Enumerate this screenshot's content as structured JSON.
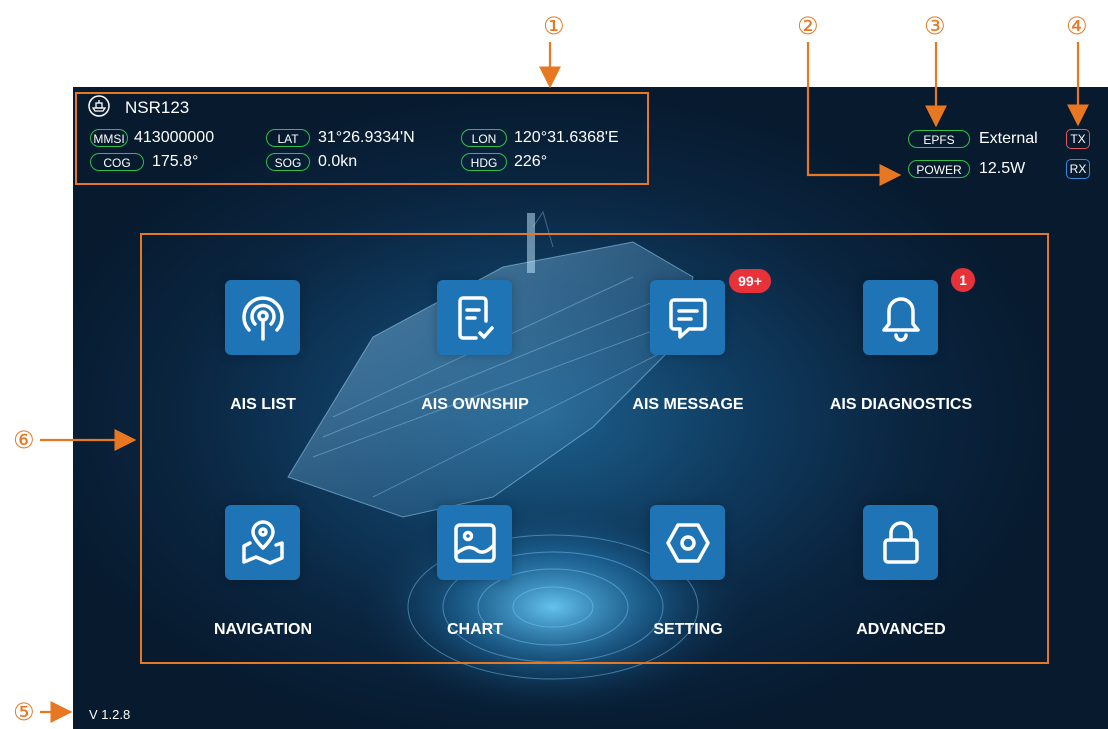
{
  "markers": {
    "m1": "①",
    "m2": "②",
    "m3": "③",
    "m4": "④",
    "m5": "⑤",
    "m6": "⑥"
  },
  "status_bar": {
    "ship_name": "NSR123",
    "mmsi_tag": "MMSI",
    "mmsi_value": "413000000",
    "lat_tag": "LAT",
    "lat_value": "31°26.9334'N",
    "lon_tag": "LON",
    "lon_value": "120°31.6368'E",
    "cog_tag": "COG",
    "cog_value": "175.8°",
    "sog_tag": "SOG",
    "sog_value": "0.0kn",
    "hdg_tag": "HDG",
    "hdg_value": "226°",
    "epfs_tag": "EPFS",
    "epfs_value": "External",
    "power_tag": "POWER",
    "power_value": "12.5W",
    "tx_label": "TX",
    "rx_label": "RX"
  },
  "menu": {
    "ais_list": "AIS LIST",
    "ais_ownship": "AIS OWNSHIP",
    "ais_message": "AIS MESSAGE",
    "ais_message_badge": "99+",
    "ais_diagnostics": "AIS DIAGNOSTICS",
    "ais_diagnostics_badge": "1",
    "navigation": "NAVIGATION",
    "chart": "CHART",
    "setting": "SETTING",
    "advanced": "ADVANCED"
  },
  "version": "V 1.2.8",
  "colors": {
    "accent": "#e87722",
    "tile": "#1f74b5",
    "badge": "#e8323a",
    "tag_border": "#2fbf4a",
    "tx": "#e0575f",
    "rx": "#3a8be0"
  },
  "icons": [
    "ship-icon",
    "signal-tower-icon",
    "document-check-icon",
    "message-icon",
    "bell-icon",
    "map-pin-icon",
    "image-icon",
    "hexagon-nut-icon",
    "lock-icon"
  ]
}
